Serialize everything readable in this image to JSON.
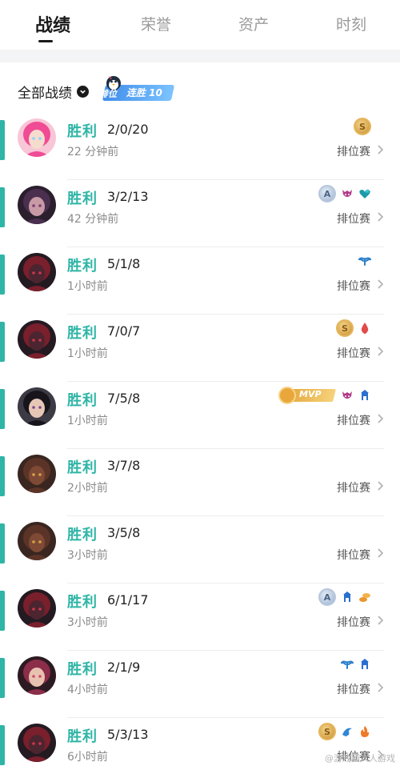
{
  "tabs": [
    {
      "label": "战绩",
      "active": true
    },
    {
      "label": "荣誉",
      "active": false
    },
    {
      "label": "资产",
      "active": false
    },
    {
      "label": "时刻",
      "active": false
    }
  ],
  "filter": {
    "label": "全部战绩"
  },
  "streak": {
    "rank_label": "排位",
    "text": "连胜 10"
  },
  "colors": {
    "win": "#2fb5a6",
    "accent_bar": "#2fb5a6"
  },
  "matches": [
    {
      "result": "胜利",
      "kda": "2/0/20",
      "time": "22 分钟前",
      "mode": "排位赛",
      "badges": [
        "S"
      ],
      "avatar": "pink-hair-champion"
    },
    {
      "result": "胜利",
      "kda": "3/2/13",
      "time": "42 分钟前",
      "mode": "排位赛",
      "badges": [
        "A",
        "demon",
        "heart"
      ],
      "avatar": "dark-hooded-champion"
    },
    {
      "result": "胜利",
      "kda": "5/1/8",
      "time": "1小时前",
      "mode": "排位赛",
      "badges": [
        "wings"
      ],
      "avatar": "red-armored-champion"
    },
    {
      "result": "胜利",
      "kda": "7/0/7",
      "time": "1小时前",
      "mode": "排位赛",
      "badges": [
        "S",
        "blood"
      ],
      "avatar": "red-armored-champion"
    },
    {
      "result": "胜利",
      "kda": "7/5/8",
      "time": "1小时前",
      "mode": "排位赛",
      "badges": [
        "MVP",
        "demon",
        "tower"
      ],
      "avatar": "dark-hair-champion"
    },
    {
      "result": "胜利",
      "kda": "3/7/8",
      "time": "2小时前",
      "mode": "排位赛",
      "badges": [],
      "avatar": "beast-champion"
    },
    {
      "result": "胜利",
      "kda": "3/5/8",
      "time": "3小时前",
      "mode": "排位赛",
      "badges": [],
      "avatar": "beast-champion"
    },
    {
      "result": "胜利",
      "kda": "6/1/17",
      "time": "3小时前",
      "mode": "排位赛",
      "badges": [
        "A",
        "tower",
        "coins"
      ],
      "avatar": "red-armored-champion"
    },
    {
      "result": "胜利",
      "kda": "2/1/9",
      "time": "4小时前",
      "mode": "排位赛",
      "badges": [
        "wings",
        "tower"
      ],
      "avatar": "hooded-red-champion"
    },
    {
      "result": "胜利",
      "kda": "5/3/13",
      "time": "6小时前",
      "mode": "排位赛",
      "badges": [
        "S",
        "dragon",
        "fire"
      ],
      "avatar": "red-armored-champion"
    }
  ],
  "watermark": "@游戏圈六人游戏"
}
